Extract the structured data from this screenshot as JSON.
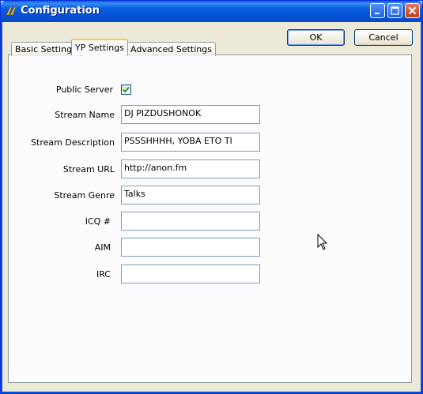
{
  "window": {
    "title": "Configuration"
  },
  "buttons": {
    "ok": "OK",
    "cancel": "Cancel"
  },
  "tabs": [
    {
      "label": "Basic Settings",
      "active": false
    },
    {
      "label": "YP Settings",
      "active": true
    },
    {
      "label": "Advanced Settings",
      "active": false
    }
  ],
  "form": {
    "public_server": {
      "label": "Public Server",
      "checked": true
    },
    "stream_name": {
      "label": "Stream Name",
      "value": "DJ PIZDUSHONOK"
    },
    "stream_description": {
      "label": "Stream Description",
      "value": "PSSSHHHH, YOBA ETO TI"
    },
    "stream_url": {
      "label": "Stream URL",
      "value": "http://anon.fm"
    },
    "stream_genre": {
      "label": "Stream Genre",
      "value": "Talks"
    },
    "icq": {
      "label": "ICQ #",
      "value": ""
    },
    "aim": {
      "label": "AIM",
      "value": ""
    },
    "irc": {
      "label": "IRC",
      "value": ""
    }
  },
  "colors": {
    "titlebar": "#0553d6",
    "window_bg": "#ece9d8",
    "check": "#21a121"
  },
  "icons": [
    "app-icon",
    "minimize-icon",
    "maximize-icon",
    "close-icon",
    "check-icon",
    "mouse-cursor-icon"
  ]
}
